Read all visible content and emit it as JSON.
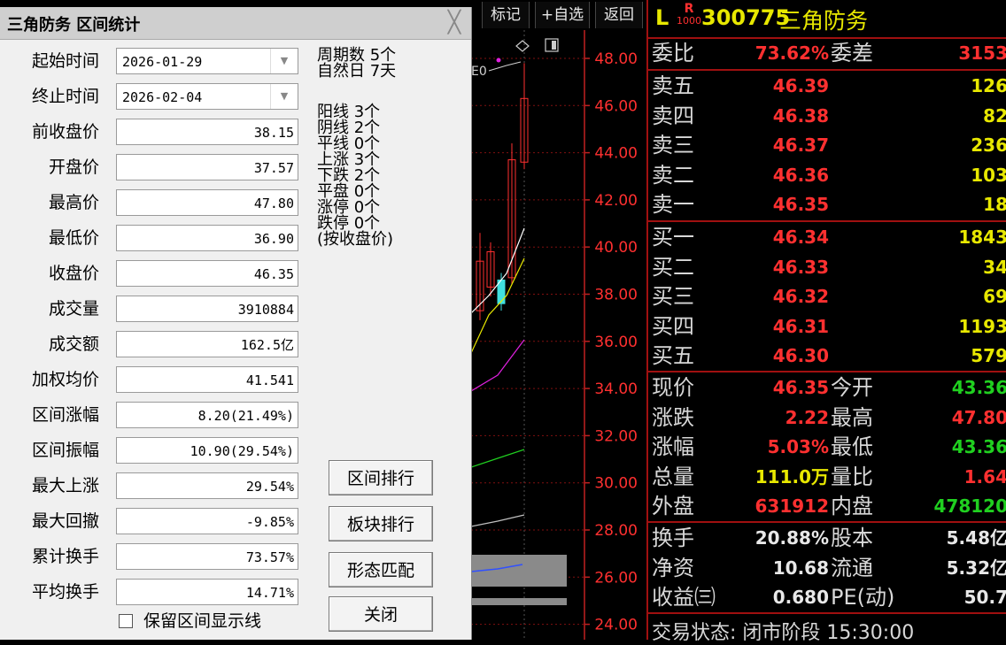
{
  "dialog": {
    "title": "三角防务 区间统计",
    "close_glyph": "╳",
    "fields": [
      {
        "label": "起始时间",
        "value": "2026-01-29",
        "type": "combo"
      },
      {
        "label": "终止时间",
        "value": "2026-02-04",
        "type": "combo"
      },
      {
        "label": "前收盘价",
        "value": "38.15"
      },
      {
        "label": "开盘价",
        "value": "37.57"
      },
      {
        "label": "最高价",
        "value": "47.80"
      },
      {
        "label": "最低价",
        "value": "36.90"
      },
      {
        "label": "收盘价",
        "value": "46.35"
      },
      {
        "label": "成交量",
        "value": "3910884"
      },
      {
        "label": "成交额",
        "value": "162.5亿"
      },
      {
        "label": "加权均价",
        "value": "41.541"
      },
      {
        "label": "区间涨幅",
        "value": "8.20(21.49%)"
      },
      {
        "label": "区间振幅",
        "value": "10.90(29.54%)"
      },
      {
        "label": "最大上涨",
        "value": "29.54%"
      },
      {
        "label": "最大回撤",
        "value": "-9.85%"
      },
      {
        "label": "累计换手",
        "value": "73.57%"
      },
      {
        "label": "平均换手",
        "value": "14.71%"
      }
    ],
    "stats": [
      "周期数 5个",
      "自然日 7天",
      "阳线 3个",
      "阴线 2个",
      "平线 0个",
      "上涨 3个",
      "下跌 2个",
      "平盘 0个",
      "涨停 0个",
      "跌停 0个",
      "(按收盘价)"
    ],
    "buttons": {
      "range_rank": "区间排行",
      "sector_rank": "板块排行",
      "pattern_match": "形态匹配",
      "close": "关闭"
    },
    "keep_lines_label": "保留区间显示线"
  },
  "toolbar": {
    "mark": "标记",
    "add_fav": "+自选",
    "back": "返回"
  },
  "chart": {
    "price_ticks": [
      "48.00",
      "46.00",
      "44.00",
      "42.00",
      "40.00",
      "38.00",
      "36.00",
      "34.00",
      "32.00",
      "30.00",
      "28.00",
      "26.00",
      "24.00"
    ],
    "partial_label": "E0"
  },
  "quote": {
    "prefix": "L",
    "badge_top": "R",
    "badge_bottom": "1000",
    "code": "300775",
    "name": "三角防务",
    "weibi_label": "委比",
    "weibi_value": "73.62%",
    "weicha_label": "委差",
    "weicha_value": "3153",
    "sells": [
      {
        "label": "卖五",
        "price": "46.39",
        "vol": "126"
      },
      {
        "label": "卖四",
        "price": "46.38",
        "vol": "82"
      },
      {
        "label": "卖三",
        "price": "46.37",
        "vol": "236"
      },
      {
        "label": "卖二",
        "price": "46.36",
        "vol": "103"
      },
      {
        "label": "卖一",
        "price": "46.35",
        "vol": "18"
      }
    ],
    "buys": [
      {
        "label": "买一",
        "price": "46.34",
        "vol": "1843"
      },
      {
        "label": "买二",
        "price": "46.33",
        "vol": "34"
      },
      {
        "label": "买三",
        "price": "46.32",
        "vol": "69"
      },
      {
        "label": "买四",
        "price": "46.31",
        "vol": "1193"
      },
      {
        "label": "买五",
        "price": "46.30",
        "vol": "579"
      }
    ],
    "stats": [
      {
        "l1": "现价",
        "v1": "46.35",
        "c1": "#ff3030",
        "l2": "今开",
        "v2": "43.36",
        "c2": "#20d020"
      },
      {
        "l1": "涨跌",
        "v1": "2.22",
        "c1": "#ff3030",
        "l2": "最高",
        "v2": "47.80",
        "c2": "#ff3030"
      },
      {
        "l1": "涨幅",
        "v1": "5.03%",
        "c1": "#ff3030",
        "l2": "最低",
        "v2": "43.36",
        "c2": "#20d020"
      },
      {
        "l1": "总量",
        "v1": "111.0万",
        "c1": "#e8e800",
        "l2": "量比",
        "v2": "1.64",
        "c2": "#ff3030"
      },
      {
        "l1": "外盘",
        "v1": "631912",
        "c1": "#ff3030",
        "l2": "内盘",
        "v2": "478120",
        "c2": "#20d020"
      }
    ],
    "stats2": [
      {
        "l1": "换手",
        "v1": "20.88%",
        "l2": "股本",
        "v2": "5.48亿"
      },
      {
        "l1": "净资",
        "v1": "10.68",
        "l2": "流通",
        "v2": "5.32亿"
      },
      {
        "l1": "收益㈢",
        "v1": "0.680",
        "l2": "PE(动)",
        "v2": "50.7"
      }
    ],
    "status": "交易状态: 闭市阶段 15:30:00"
  },
  "colors": {
    "up": "#ff3030",
    "down": "#20d020",
    "volume": "#e8e800",
    "separator": "#a01010"
  }
}
